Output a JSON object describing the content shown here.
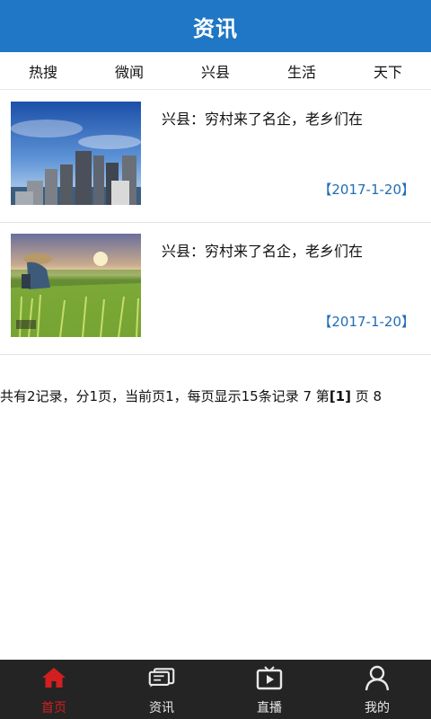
{
  "header": {
    "title": "资讯"
  },
  "tabs": [
    {
      "label": "热搜"
    },
    {
      "label": "微闻"
    },
    {
      "label": "兴县"
    },
    {
      "label": "生活"
    },
    {
      "label": "天下"
    }
  ],
  "news": [
    {
      "title": "兴县：穷村来了名企，老乡们在",
      "date": "【2017-1-20】",
      "image": "city-skyline"
    },
    {
      "title": "兴县：穷村来了名企，老乡们在",
      "date": "【2017-1-20】",
      "image": "farmer-field"
    }
  ],
  "pager": {
    "text1": "共有2记录，分1页，当前页1，每页显示15条记录 7 第",
    "current": "[1]",
    "text2": " 页 8"
  },
  "tabbar": [
    {
      "label": "首页",
      "icon": "home-icon",
      "active": true
    },
    {
      "label": "资讯",
      "icon": "news-icon",
      "active": false
    },
    {
      "label": "直播",
      "icon": "tv-play-icon",
      "active": false
    },
    {
      "label": "我的",
      "icon": "user-icon",
      "active": false
    }
  ],
  "colors": {
    "brand": "#1f77c5",
    "active_tab": "#d31f1f",
    "date": "#1f6db5",
    "tabbar_bg": "#242424"
  }
}
